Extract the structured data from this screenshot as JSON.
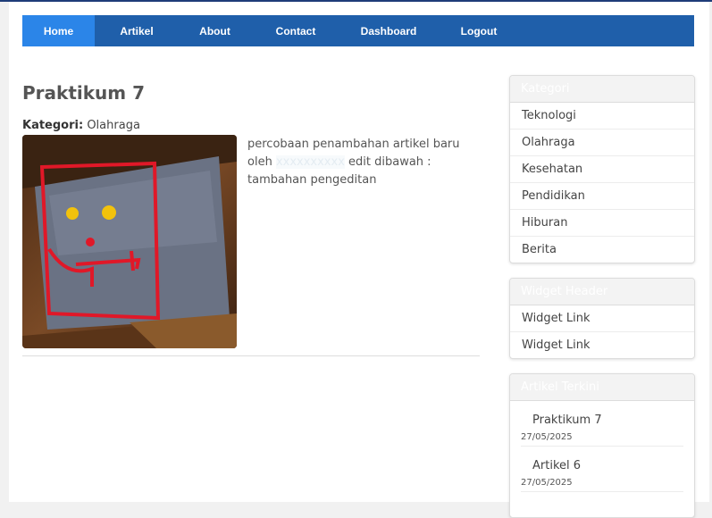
{
  "nav": {
    "items": [
      {
        "label": "Home",
        "active": true
      },
      {
        "label": "Artikel"
      },
      {
        "label": "About"
      },
      {
        "label": "Contact"
      },
      {
        "label": "Dashboard"
      },
      {
        "label": "Logout"
      }
    ]
  },
  "article": {
    "title": "Praktikum 7",
    "category_label": "Kategori:",
    "category_value": "Olahraga",
    "text_before": "percobaan penambahan artikel baru oleh",
    "text_hidden": "xxxxxxxxxx",
    "text_after": "edit dibawah : tambahan pengeditan"
  },
  "sidebar": {
    "kategori": {
      "title": "Kategori",
      "items": [
        "Teknologi",
        "Olahraga",
        "Kesehatan",
        "Pendidikan",
        "Hiburan",
        "Berita"
      ]
    },
    "widget": {
      "title": "Widget Header",
      "items": [
        "Widget Link",
        "Widget Link"
      ]
    },
    "recent": {
      "title": "Artikel Terkini",
      "items": [
        {
          "title": "Praktikum 7",
          "date": "27/05/2025"
        },
        {
          "title": "Artikel 6",
          "date": "27/05/2025"
        }
      ]
    }
  },
  "colors": {
    "nav_bg": "#1f5faa",
    "nav_active": "#2b85e8"
  }
}
